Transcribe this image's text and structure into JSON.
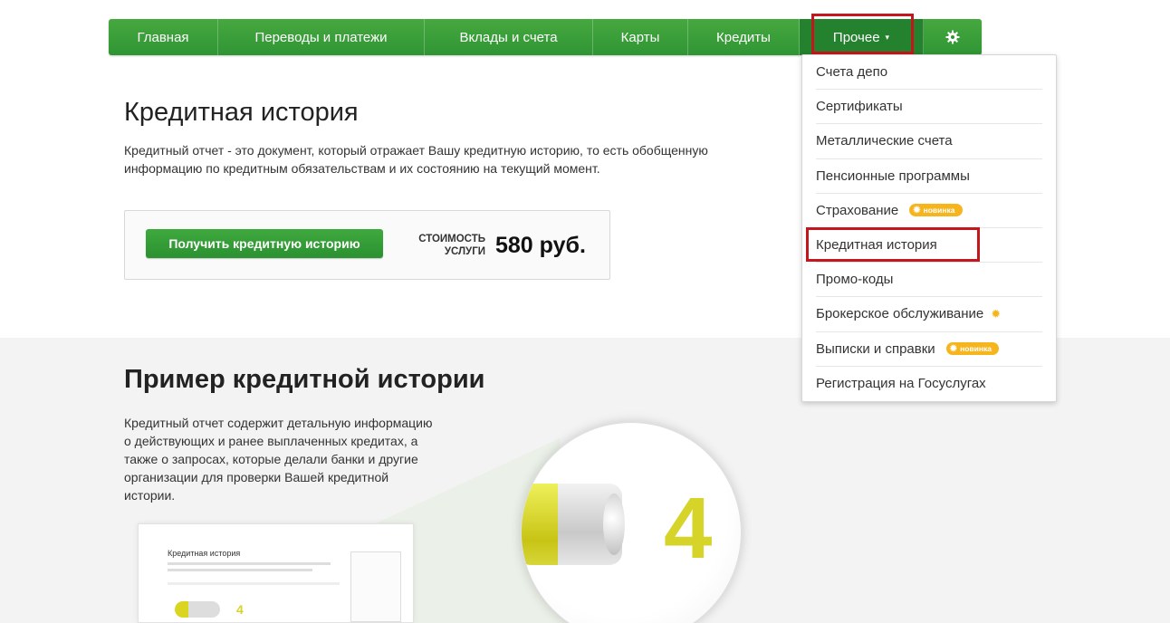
{
  "nav": {
    "items": [
      {
        "label": "Главная"
      },
      {
        "label": "Переводы и платежи"
      },
      {
        "label": "Вклады и счета"
      },
      {
        "label": "Карты"
      },
      {
        "label": "Кредиты"
      },
      {
        "label": "Прочее"
      }
    ],
    "settings_icon": "gear-icon",
    "caret": "▾"
  },
  "credit_history": {
    "title": "Кредитная история",
    "description": "Кредитный отчет - это документ, который отражает Вашу кредитную историю, то есть обобщенную информацию по кредитным обязательствам и их состоянию на текущий момент.",
    "button": "Получить кредитную историю",
    "cost_label_1": "Стоимость",
    "cost_label_2": "услуги",
    "price": "580 руб."
  },
  "example": {
    "title": "Пример кредитной истории",
    "description": "Кредитный отчет содержит детальную информацию о действующих и ранее выплаченных кредитах, а также о запросах, которые делали банки и другие организации для проверки Вашей кредитной истории.",
    "thumb_title": "Кредитная история",
    "rating": "4"
  },
  "dropdown": {
    "items": [
      {
        "label": "Счета депо"
      },
      {
        "label": "Сертификаты"
      },
      {
        "label": "Металлические счета"
      },
      {
        "label": "Пенсионные программы"
      },
      {
        "label": "Страхование",
        "badge": "новинка"
      },
      {
        "label": "Кредитная история"
      },
      {
        "label": "Промо-коды"
      },
      {
        "label": "Брокерское обслуживание"
      },
      {
        "label": "Выписки и справки",
        "badge": "новинка"
      },
      {
        "label": "Регистрация на Госуслугах"
      }
    ]
  },
  "colors": {
    "brand_green": "#2f9534",
    "highlight_red": "#c4161c",
    "badge_yellow": "#f6b51c",
    "rating_yellow": "#d6d329"
  }
}
